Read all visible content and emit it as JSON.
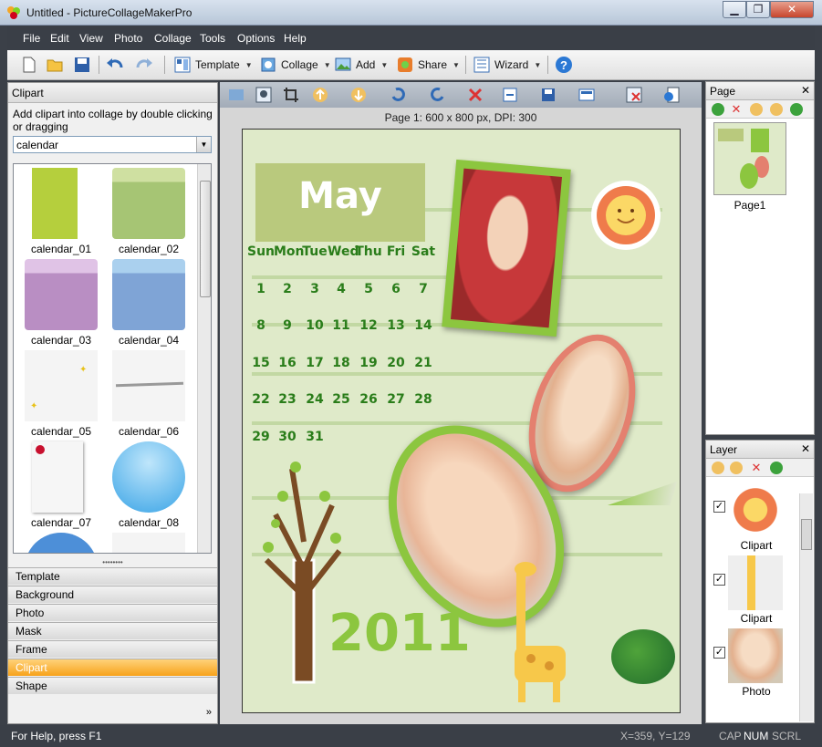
{
  "window": {
    "title": "Untitled - PictureCollageMakerPro",
    "minimize": "▁",
    "restore": "❐",
    "close": "✕"
  },
  "menu": [
    "File",
    "Edit",
    "View",
    "Photo",
    "Collage",
    "Tools",
    "Options",
    "Help"
  ],
  "toolbar": {
    "template": "Template",
    "collage": "Collage",
    "add": "Add",
    "share": "Share",
    "wizard": "Wizard",
    "help": "?"
  },
  "left_panel": {
    "header": "Clipart",
    "hint": "Add clipart into collage by double clicking or dragging",
    "category": "calendar",
    "thumbnails": [
      {
        "label": "calendar_01",
        "color": "#b5cf3d"
      },
      {
        "label": "calendar_02",
        "color": "#a6c574"
      },
      {
        "label": "calendar_03",
        "color": "#b98ec3"
      },
      {
        "label": "calendar_04",
        "color": "#7fa4d6"
      },
      {
        "label": "calendar_05",
        "color": "#f4f4f4"
      },
      {
        "label": "calendar_06",
        "color": "#f4f4f4"
      },
      {
        "label": "calendar_07",
        "color": "#f6f6f6"
      },
      {
        "label": "calendar_08",
        "color": "#56b8ea"
      }
    ],
    "tabs": [
      "Template",
      "Background",
      "Photo",
      "Mask",
      "Frame",
      "Clipart",
      "Shape"
    ],
    "active_tab": "Clipart",
    "more": "»"
  },
  "canvas": {
    "page_info": "Page 1: 600 x 800 px, DPI: 300",
    "month": "May",
    "weekdays": [
      "Sun",
      "Mon",
      "Tue",
      "Wed",
      "Thu",
      "Fri",
      "Sat"
    ],
    "weeks": [
      [
        "1",
        "2",
        "3",
        "4",
        "5",
        "6",
        "7"
      ],
      [
        "8",
        "9",
        "10",
        "11",
        "12",
        "13",
        "14"
      ],
      [
        "15",
        "16",
        "17",
        "18",
        "19",
        "20",
        "21"
      ],
      [
        "22",
        "23",
        "24",
        "25",
        "26",
        "27",
        "28"
      ],
      [
        "29",
        "30",
        "31"
      ]
    ],
    "year": "2011"
  },
  "page_panel": {
    "header": "Page",
    "close": "✕",
    "page_label": "Page1"
  },
  "layer_panel": {
    "header": "Layer",
    "close": "✕",
    "layers": [
      "Clipart",
      "Clipart",
      "Photo"
    ]
  },
  "status": {
    "help": "For Help, press F1",
    "coords": "X=359, Y=129",
    "cap": "CAP",
    "num": "NUM",
    "scrl": "SCRL"
  }
}
